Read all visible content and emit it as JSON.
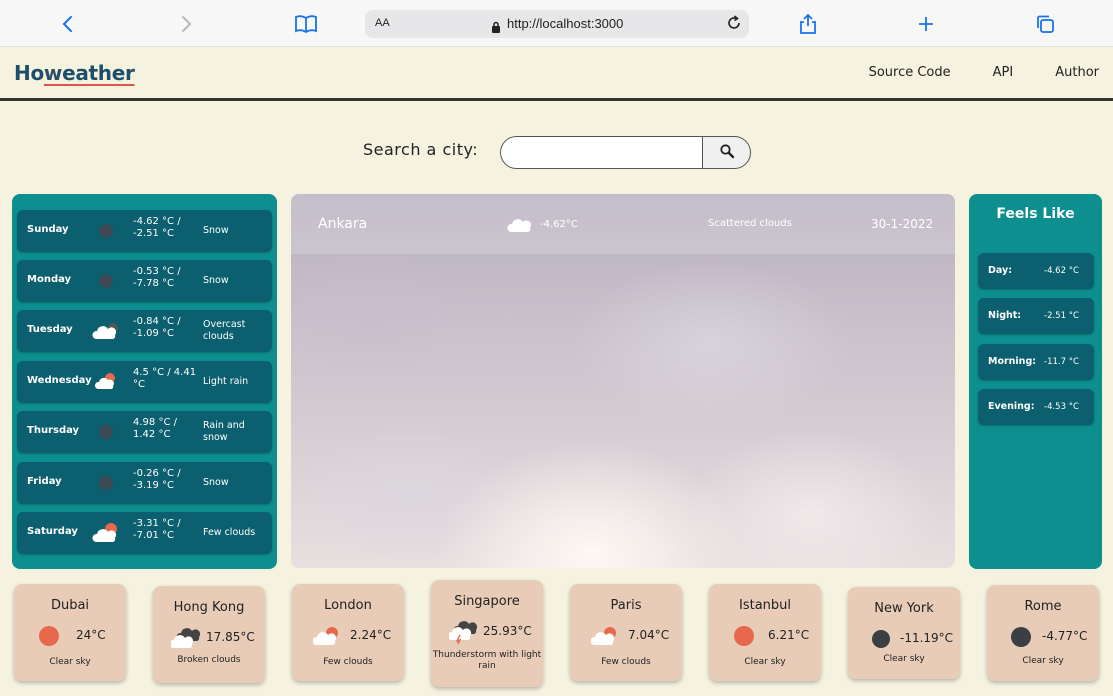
{
  "browser": {
    "aa_label": "AA",
    "url": "http://localhost:3000"
  },
  "nav": {
    "logo_ho": "Ho",
    "logo_w": "w",
    "logo_rest": "eather",
    "links": [
      "Source Code",
      "API",
      "Author"
    ]
  },
  "search": {
    "label": "Search a city:",
    "value": "",
    "placeholder": ""
  },
  "forecast": [
    {
      "day": "Sunday",
      "temp": "-4.62 °C / -2.51 °C",
      "desc": "Snow",
      "icon": "snow-icon"
    },
    {
      "day": "Monday",
      "temp": "-0.53 °C / -7.78 °C",
      "desc": "Snow",
      "icon": "snow-icon"
    },
    {
      "day": "Tuesday",
      "temp": "-0.84 °C / -1.09 °C",
      "desc": "Overcast clouds",
      "icon": "overcast-clouds-icon"
    },
    {
      "day": "Wednesday",
      "temp": "4.5 °C / 4.41 °C",
      "desc": "Light rain",
      "icon": "light-rain-icon"
    },
    {
      "day": "Thursday",
      "temp": "4.98 °C / 1.42 °C",
      "desc": "Rain and snow",
      "icon": "rain-snow-icon"
    },
    {
      "day": "Friday",
      "temp": "-0.26 °C / -3.19 °C",
      "desc": "Snow",
      "icon": "snow-icon"
    },
    {
      "day": "Saturday",
      "temp": "-3.31 °C / -7.01 °C",
      "desc": "Few clouds",
      "icon": "few-clouds-icon"
    }
  ],
  "current": {
    "city": "Ankara",
    "temp": "-4.62°C",
    "desc": "Scattered clouds",
    "date": "30-1-2022"
  },
  "feels_like": {
    "title": "Feels Like",
    "rows": [
      {
        "label": "Day:",
        "value": "-4.62 °C"
      },
      {
        "label": "Night:",
        "value": "-2.51 °C"
      },
      {
        "label": "Morning:",
        "value": "-11.7 °C"
      },
      {
        "label": "Evening:",
        "value": "-4.53 °C"
      }
    ]
  },
  "cities": [
    {
      "name": "Dubai",
      "temp": "24°C",
      "desc": "Clear sky",
      "icon": "sun-icon"
    },
    {
      "name": "Hong Kong",
      "temp": "17.85°C",
      "desc": "Broken clouds",
      "icon": "broken-clouds-icon"
    },
    {
      "name": "London",
      "temp": "2.24°C",
      "desc": "Few clouds",
      "icon": "few-clouds-icon"
    },
    {
      "name": "Singapore",
      "temp": "25.93°C",
      "desc": "Thunderstorm with light rain",
      "icon": "thunderstorm-icon"
    },
    {
      "name": "Paris",
      "temp": "7.04°C",
      "desc": "Few clouds",
      "icon": "few-clouds-icon"
    },
    {
      "name": "Istanbul",
      "temp": "6.21°C",
      "desc": "Clear sky",
      "icon": "sun-icon"
    },
    {
      "name": "New York",
      "temp": "-11.19°C",
      "desc": "Clear sky",
      "icon": "moon-icon"
    },
    {
      "name": "Rome",
      "temp": "-4.77°C",
      "desc": "Clear sky",
      "icon": "moon-icon"
    }
  ],
  "colors": {
    "panel": "#0d8f8f",
    "row": "#0b5f6e",
    "card": "#e8ccb8",
    "page": "#f5f2e0",
    "accent": "#d8584a"
  }
}
